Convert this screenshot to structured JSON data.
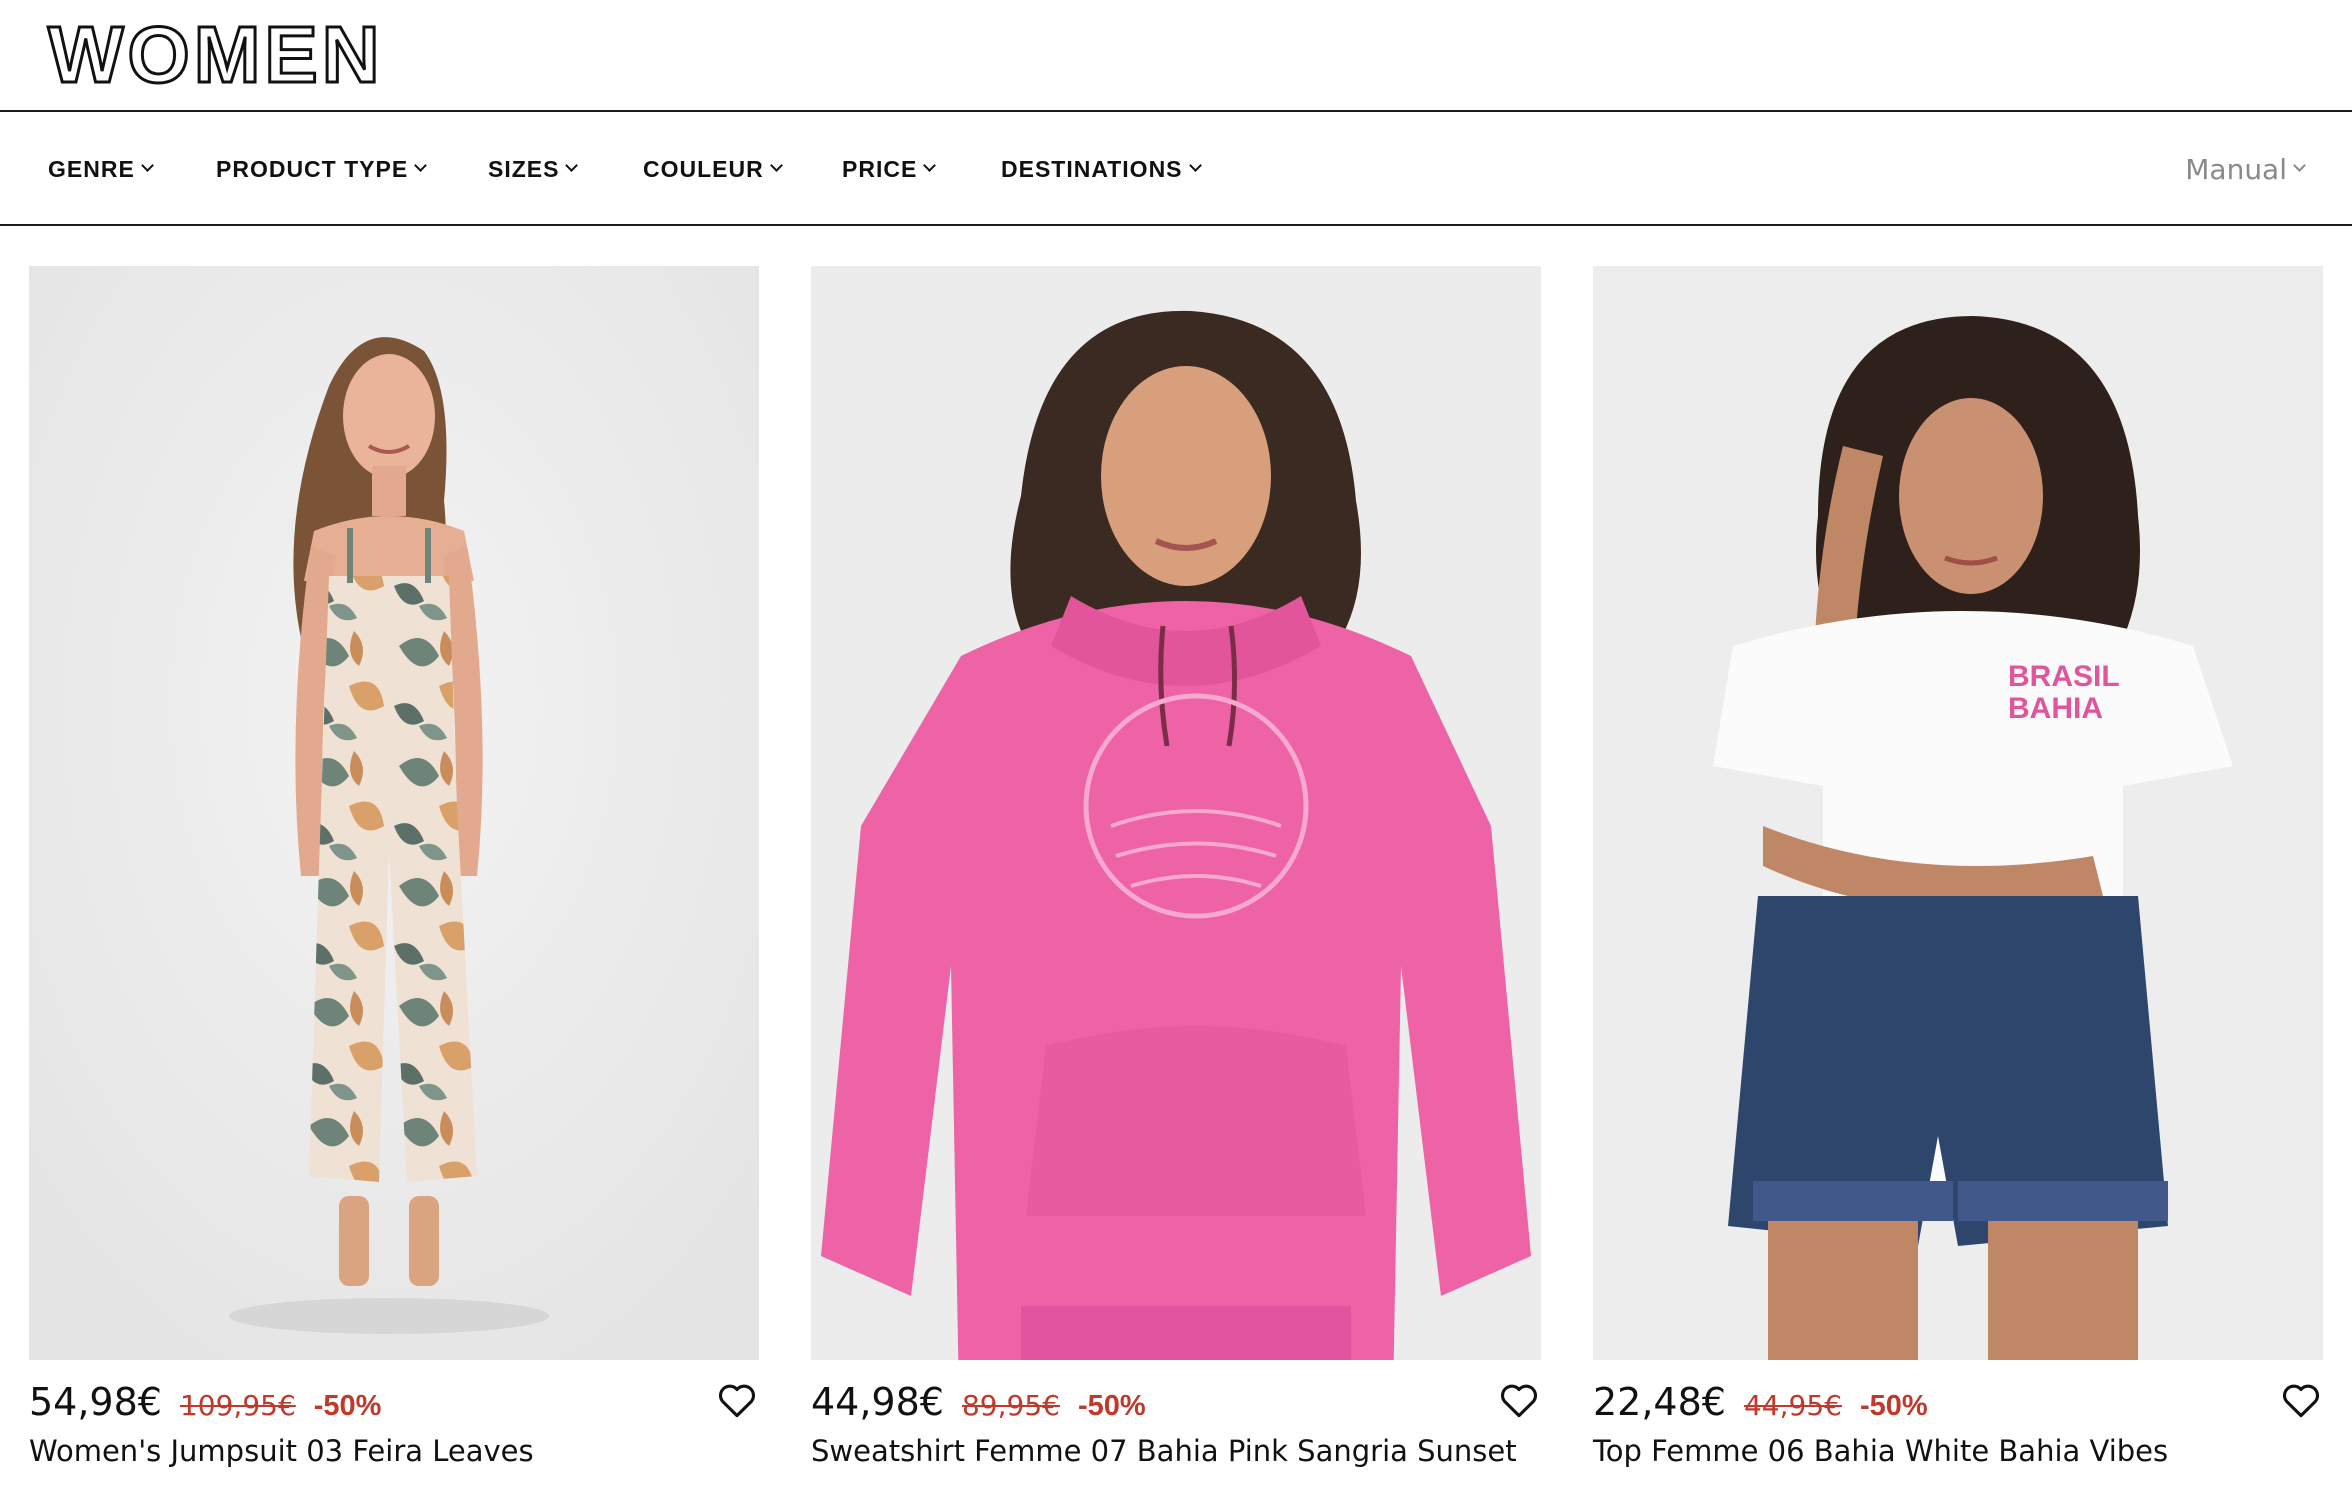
{
  "page": {
    "title": "WOMEN"
  },
  "filters": [
    {
      "label": "GENRE"
    },
    {
      "label": "PRODUCT TYPE"
    },
    {
      "label": "SIZES"
    },
    {
      "label": "COULEUR"
    },
    {
      "label": "PRICE"
    },
    {
      "label": "DESTINATIONS"
    }
  ],
  "sort": {
    "label": "Manual"
  },
  "products": [
    {
      "name": "Women's Jumpsuit 03 Feira Leaves",
      "price": "54,98€",
      "old_price": "109,95€",
      "discount": "-50%"
    },
    {
      "name": "Sweatshirt Femme 07 Bahia Pink Sangria Sunset",
      "price": "44,98€",
      "old_price": "89,95€",
      "discount": "-50%"
    },
    {
      "name": "Top Femme 06 Bahia White Bahia Vibes",
      "price": "22,48€",
      "old_price": "44,95€",
      "discount": "-50%",
      "print_text": "BRASIL BAHIA"
    }
  ],
  "colors": {
    "discount": "#c0392b",
    "sort": "#8a8a8a",
    "hoodie": "#ee62a6",
    "denim": "#2f466c"
  },
  "icons": {
    "wishlist": "heart-outline-icon",
    "dropdown": "chevron-down-icon"
  }
}
